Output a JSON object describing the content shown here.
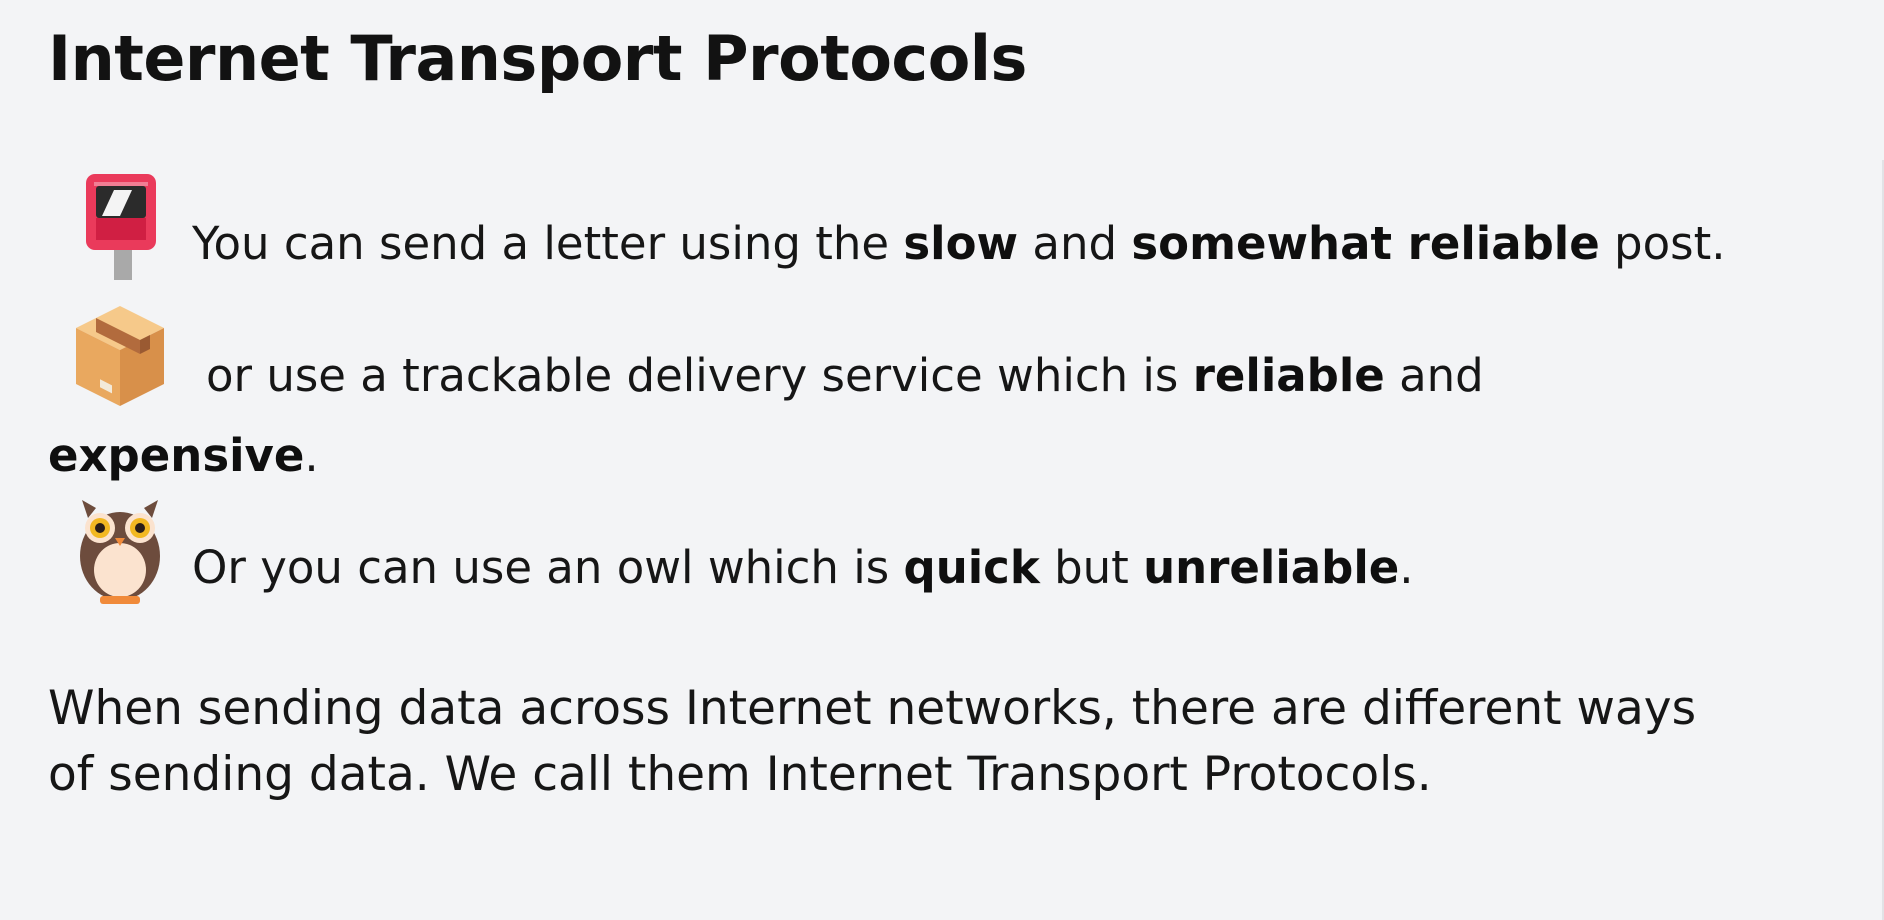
{
  "slide": {
    "title": "Internet Transport Protocols",
    "items": [
      {
        "icon": "postbox-icon",
        "parts": [
          "You can send a letter using the ",
          "slow",
          " and ",
          "somewhat reliable",
          " post."
        ]
      },
      {
        "icon": "package-icon",
        "parts": [
          "or use a trackable delivery service which is ",
          "reliable",
          " and"
        ],
        "continuation": [
          "expensive",
          "."
        ]
      },
      {
        "icon": "owl-icon",
        "parts": [
          "Or you can use an owl which is ",
          "quick",
          " but ",
          "unreliable",
          "."
        ]
      }
    ],
    "summary": {
      "line1": "When sending data across Internet networks, there are different ways",
      "line2": "of sending data. We call them Internet Transport Protocols."
    },
    "colors": {
      "background": "#f3f4f6",
      "text": "#111111",
      "postbox": "#ea3a5b",
      "package": "#e7a45c",
      "owl": "#6d4c3d"
    }
  }
}
